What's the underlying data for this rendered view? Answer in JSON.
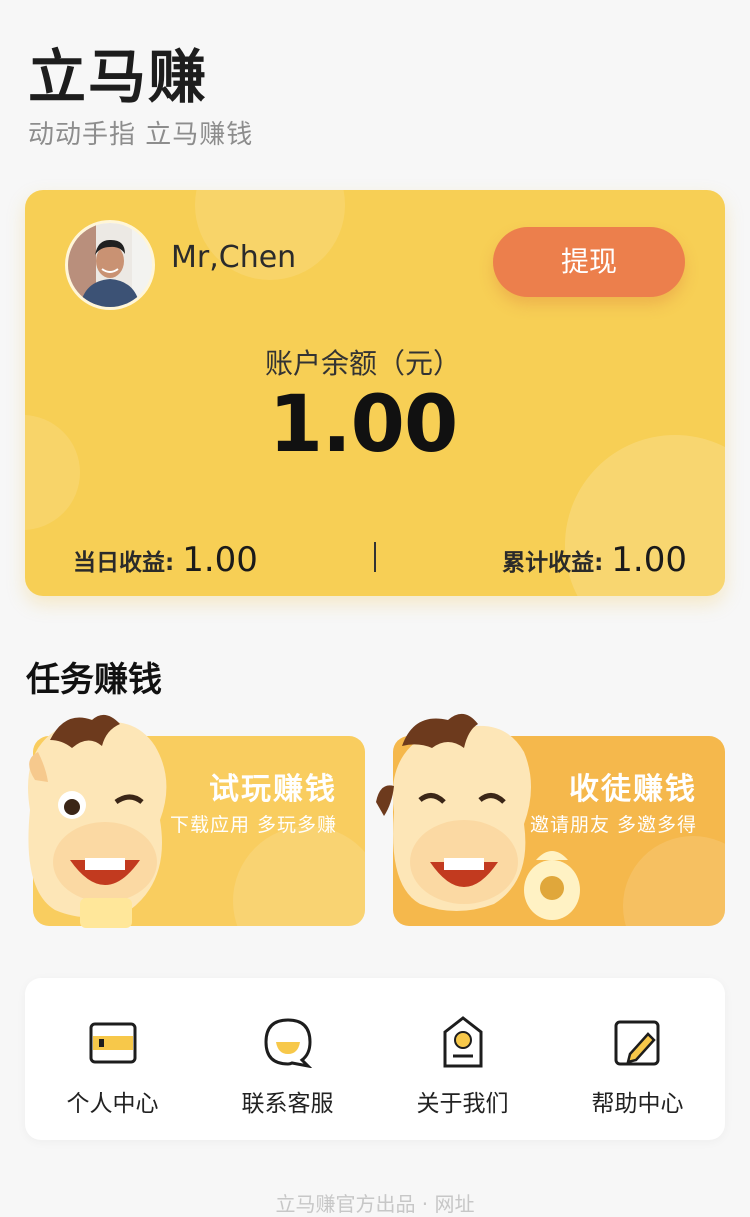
{
  "header": {
    "title": "立马赚",
    "subtitle": "动动手指 立马赚钱"
  },
  "account": {
    "username": "Mr,Chen",
    "withdraw_label": "提现",
    "balance_label": "账户余额（元）",
    "balance": "1.00",
    "today_label": "当日收益:",
    "today_value": "1.00",
    "total_label": "累计收益:",
    "total_value": "1.00"
  },
  "tasks": {
    "section_title": "任务赚钱",
    "items": [
      {
        "title": "试玩赚钱",
        "desc": "下载应用 多玩多赚"
      },
      {
        "title": "收徒赚钱",
        "desc": "邀请朋友 多邀多得"
      }
    ]
  },
  "menu": {
    "items": [
      {
        "label": "个人中心",
        "icon": "wallet-icon"
      },
      {
        "label": "联系客服",
        "icon": "chat-icon"
      },
      {
        "label": "关于我们",
        "icon": "tag-icon"
      },
      {
        "label": "帮助中心",
        "icon": "edit-icon"
      }
    ]
  },
  "footer": {
    "text": "立马赚官方出品 · 网址"
  },
  "colors": {
    "card": "#f7cf55",
    "withdraw": "#ec7f4c",
    "accent": "#f5b84c"
  }
}
